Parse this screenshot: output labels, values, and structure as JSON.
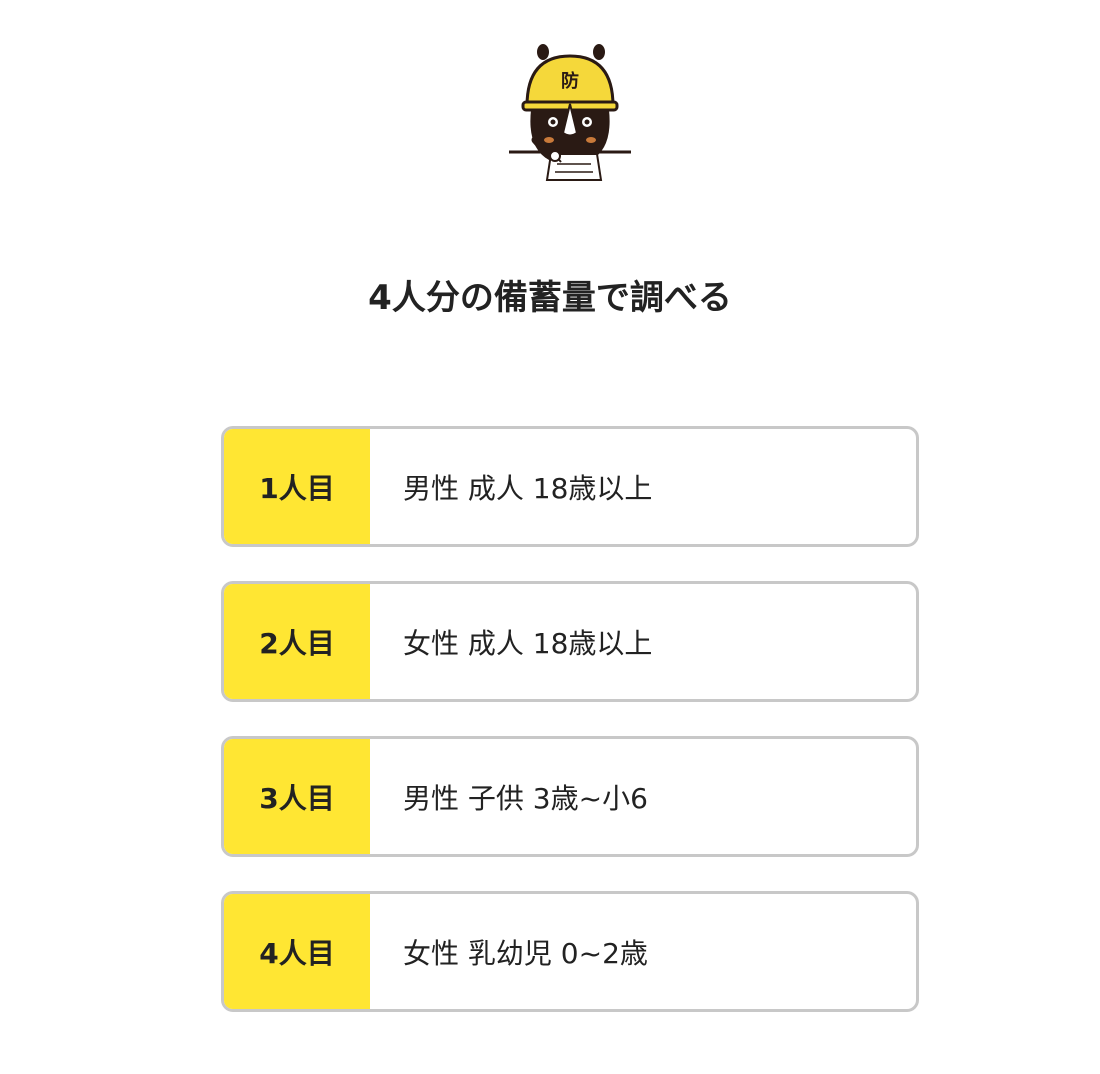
{
  "mascot": {
    "icon": "rhino-helmet-mascot-icon",
    "helmet_text": "防",
    "helmet_color": "#f5d83a",
    "body_color": "#2a1a14"
  },
  "title": "4人分の備蓄量で調べる",
  "colors": {
    "accent": "#ffe633",
    "border": "#c8c8c8",
    "text": "#222222"
  },
  "persons": [
    {
      "badge": "1人目",
      "description": "男性 成人 18歳以上"
    },
    {
      "badge": "2人目",
      "description": "女性 成人 18歳以上"
    },
    {
      "badge": "3人目",
      "description": "男性 子供 3歳~小6"
    },
    {
      "badge": "4人目",
      "description": "女性 乳幼児 0~2歳"
    }
  ]
}
